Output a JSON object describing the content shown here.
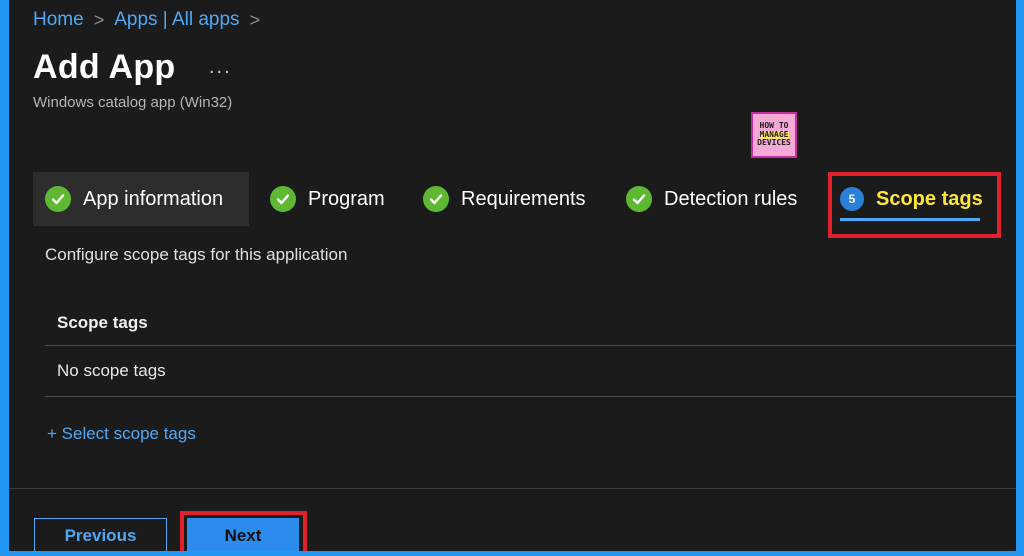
{
  "breadcrumb": {
    "items": [
      "Home",
      "Apps | All apps"
    ],
    "separator": ">"
  },
  "header": {
    "title": "Add App",
    "more": "...",
    "subtitle": "Windows catalog app (Win32)"
  },
  "logo": {
    "line1": "HOW TO",
    "line2": "MANAGE",
    "line3": "DEVICES"
  },
  "steps": [
    {
      "label": "App information",
      "status": "complete"
    },
    {
      "label": "Program",
      "status": "complete"
    },
    {
      "label": "Requirements",
      "status": "complete"
    },
    {
      "label": "Detection rules",
      "status": "complete"
    },
    {
      "label": "Scope tags",
      "status": "active",
      "number": "5"
    }
  ],
  "main": {
    "description": "Configure scope tags for this application",
    "table": {
      "header": "Scope tags",
      "rows": [
        "No scope tags"
      ]
    },
    "select_link": "+ Select scope tags"
  },
  "footer": {
    "previous_label": "Previous",
    "next_label": "Next"
  },
  "colors": {
    "accent": "#4fa8f5",
    "check": "#5fb832",
    "highlight": "#e0202c",
    "active_text": "#ffe637"
  }
}
